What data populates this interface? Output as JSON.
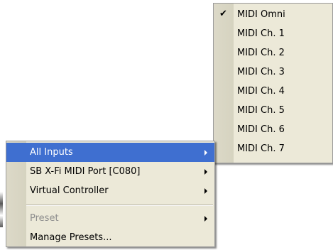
{
  "main_menu": {
    "items": [
      {
        "label": "All Inputs",
        "has_submenu": true,
        "highlighted": true
      },
      {
        "label": "SB X-Fi MIDI Port [C080]",
        "has_submenu": true
      },
      {
        "label": "Virtual Controller",
        "has_submenu": true
      },
      {
        "label": "Preset",
        "has_submenu": true,
        "disabled": true
      },
      {
        "label": "Manage Presets...",
        "has_submenu": false
      }
    ]
  },
  "sub_menu": {
    "items": [
      {
        "label": "MIDI Omni",
        "checked": true
      },
      {
        "label": "MIDI Ch. 1"
      },
      {
        "label": "MIDI Ch. 2"
      },
      {
        "label": "MIDI Ch. 3"
      },
      {
        "label": "MIDI Ch. 4"
      },
      {
        "label": "MIDI Ch. 5"
      },
      {
        "label": "MIDI Ch. 6"
      },
      {
        "label": "MIDI Ch. 7"
      }
    ],
    "check_glyph": "✔"
  },
  "colors": {
    "menu_bg": "#ece9d8",
    "highlight": "#3f6fd0",
    "disabled_text": "#8d8d8d"
  }
}
